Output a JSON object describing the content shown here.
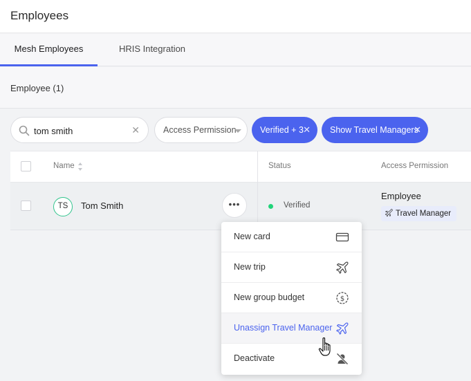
{
  "header": {
    "title": "Employees"
  },
  "tabs": [
    {
      "label": "Mesh Employees",
      "active": true
    },
    {
      "label": "HRIS Integration",
      "active": false
    }
  ],
  "summary": {
    "count_label": "Employee (1)"
  },
  "filters": {
    "search_value": "tom smith",
    "access_permission_label": "Access Permission",
    "chips": [
      {
        "label": "Verified + 3"
      },
      {
        "label": "Show Travel Managers"
      }
    ]
  },
  "table": {
    "columns": {
      "name": "Name",
      "status": "Status",
      "access": "Access Permission"
    },
    "rows": [
      {
        "initials": "TS",
        "name": "Tom Smith",
        "status": "Verified",
        "permission": "Employee",
        "badge": "Travel Manager"
      }
    ]
  },
  "menu": {
    "items": [
      {
        "label": "New card",
        "icon": "card-icon"
      },
      {
        "label": "New trip",
        "icon": "plane-icon"
      },
      {
        "label": "New group budget",
        "icon": "dollar-circle-icon"
      },
      {
        "label": "Unassign Travel Manager",
        "icon": "plane-icon",
        "highlighted": true
      },
      {
        "label": "Deactivate",
        "icon": "user-slash-icon"
      }
    ]
  },
  "colors": {
    "accent": "#4b63ee",
    "verified": "#22d47a",
    "avatar_ring": "#31c48d"
  }
}
